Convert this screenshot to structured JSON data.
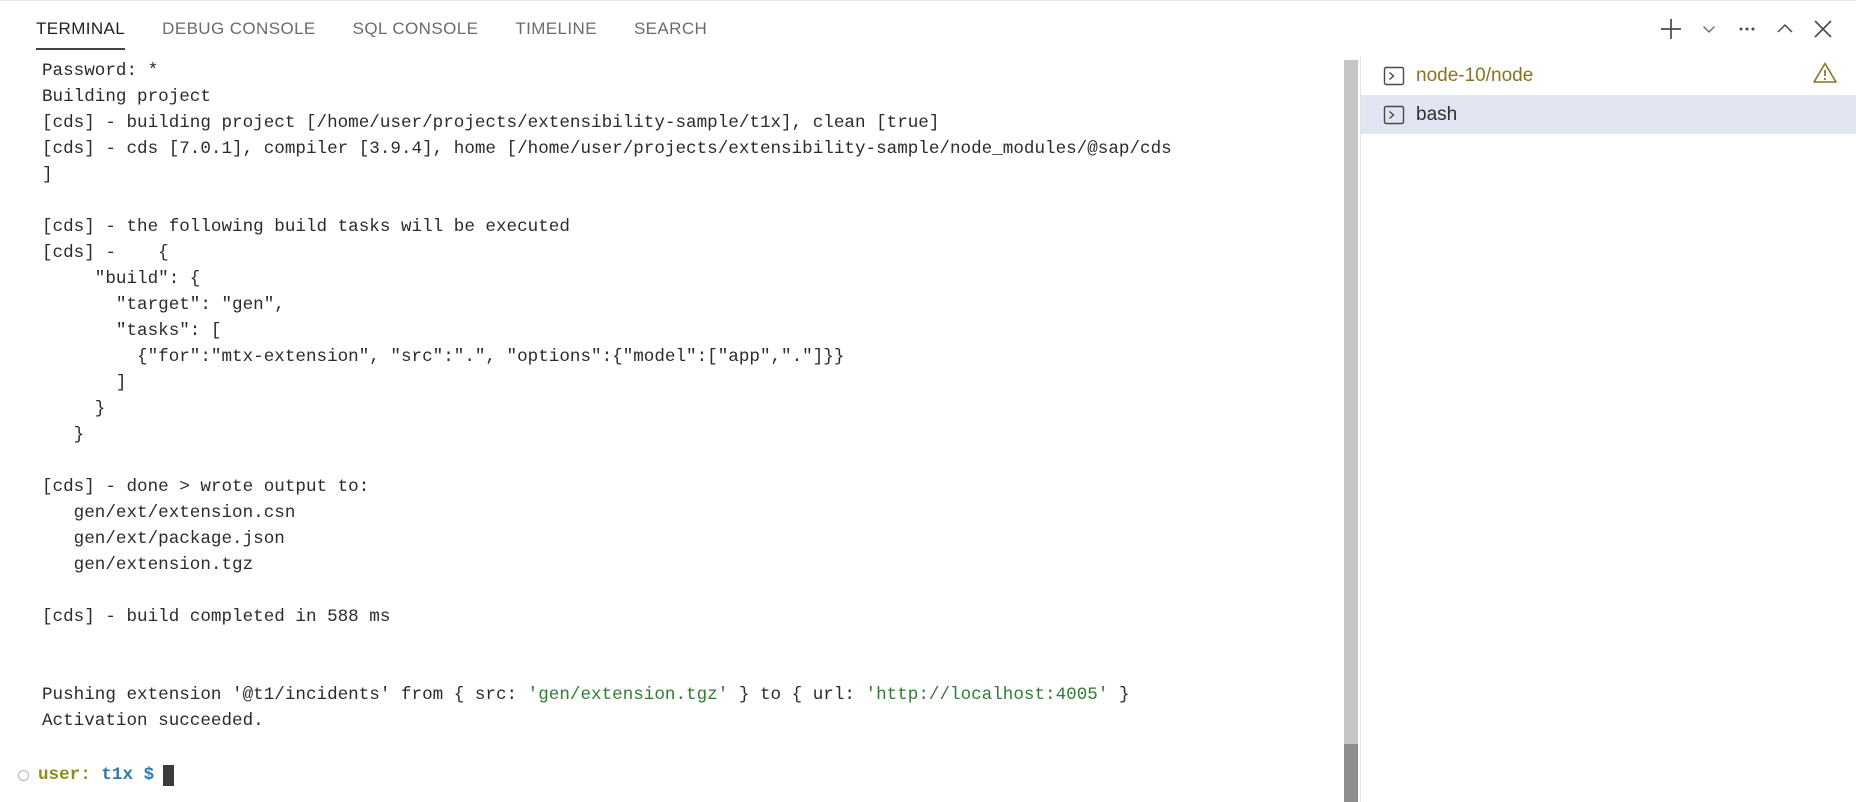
{
  "panel": {
    "tabs": [
      {
        "label": "TERMINAL",
        "active": true
      },
      {
        "label": "DEBUG CONSOLE",
        "active": false
      },
      {
        "label": "SQL CONSOLE",
        "active": false
      },
      {
        "label": "TIMELINE",
        "active": false
      },
      {
        "label": "SEARCH",
        "active": false
      }
    ],
    "actions": [
      {
        "name": "new-terminal-button",
        "icon": "plus-icon"
      },
      {
        "name": "terminal-profile-dropdown",
        "icon": "chevron-down-icon"
      },
      {
        "name": "panel-more-actions-button",
        "icon": "ellipsis-icon"
      },
      {
        "name": "maximize-panel-button",
        "icon": "chevron-up-icon"
      },
      {
        "name": "close-panel-button",
        "icon": "close-icon"
      }
    ]
  },
  "terminal": {
    "lines": [
      {
        "text": "Password: *"
      },
      {
        "text": "Building project"
      },
      {
        "text": "[cds] - building project [/home/user/projects/extensibility-sample/t1x], clean [true]"
      },
      {
        "text": "[cds] - cds [7.0.1], compiler [3.9.4], home [/home/user/projects/extensibility-sample/node_modules/@sap/cds"
      },
      {
        "text": "]"
      },
      {
        "text": ""
      },
      {
        "text": "[cds] - the following build tasks will be executed"
      },
      {
        "text": "[cds] -    {"
      },
      {
        "text": "     \"build\": {"
      },
      {
        "text": "       \"target\": \"gen\","
      },
      {
        "text": "       \"tasks\": ["
      },
      {
        "text": "         {\"for\":\"mtx-extension\", \"src\":\".\", \"options\":{\"model\":[\"app\",\".\"]}}"
      },
      {
        "text": "       ]"
      },
      {
        "text": "     }"
      },
      {
        "text": "   }"
      },
      {
        "text": ""
      },
      {
        "text": "[cds] - done > wrote output to:"
      },
      {
        "text": "   gen/ext/extension.csn"
      },
      {
        "text": "   gen/ext/package.json"
      },
      {
        "text": "   gen/extension.tgz"
      },
      {
        "text": ""
      },
      {
        "text": "[cds] - build completed in 588 ms"
      },
      {
        "text": ""
      },
      {
        "text": ""
      },
      {
        "segments": [
          {
            "text": "Pushing extension '@t1/incidents' from { src: ",
            "color": "default"
          },
          {
            "text": "'gen/extension.tgz'",
            "color": "green"
          },
          {
            "text": " } to { url: ",
            "color": "default"
          },
          {
            "text": "'http://localhost:4005'",
            "color": "green"
          },
          {
            "text": " }",
            "color": "default"
          }
        ]
      },
      {
        "text": "Activation succeeded."
      }
    ],
    "prompt": {
      "user": "user:",
      "dir": "t1x",
      "symbol": "$",
      "input": ""
    }
  },
  "terminal_list": {
    "items": [
      {
        "label": "node-10/node",
        "selected": false,
        "warning": true,
        "icon": "terminal-icon"
      },
      {
        "label": "bash",
        "selected": true,
        "warning": false,
        "icon": "terminal-icon"
      }
    ]
  },
  "colors": {
    "accent": "#3b8ad9",
    "string_green": "#2e7d32",
    "warning": "#8a7320",
    "selection": "#e1e5f1",
    "prompt_user": "#8a8f1e",
    "prompt_dir": "#2a7ab0"
  }
}
